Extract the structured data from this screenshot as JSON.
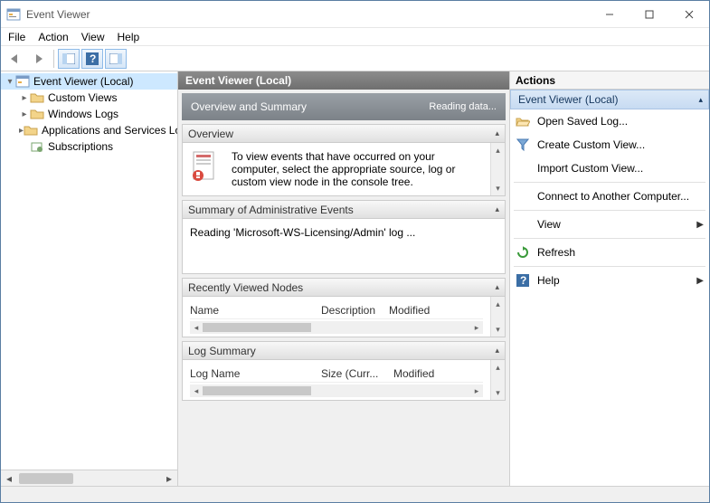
{
  "window": {
    "title": "Event Viewer"
  },
  "menu": {
    "file": "File",
    "action": "Action",
    "view": "View",
    "help": "Help"
  },
  "tree": {
    "root": "Event Viewer (Local)",
    "items": [
      {
        "label": "Custom Views"
      },
      {
        "label": "Windows Logs"
      },
      {
        "label": "Applications and Services Lo"
      },
      {
        "label": "Subscriptions"
      }
    ]
  },
  "center": {
    "header": "Event Viewer (Local)",
    "title": "Overview and Summary",
    "reading": "Reading data...",
    "overview": {
      "head": "Overview",
      "text": "To view events that have occurred on your computer, select the appropriate source, log or custom view node in the console tree."
    },
    "summary": {
      "head": "Summary of Administrative Events",
      "text": "Reading 'Microsoft-WS-Licensing/Admin' log ..."
    },
    "recent": {
      "head": "Recently Viewed Nodes",
      "cols": {
        "c1": "Name",
        "c2": "Description",
        "c3": "Modified"
      }
    },
    "logsum": {
      "head": "Log Summary",
      "cols": {
        "c1": "Log Name",
        "c2": "Size (Curr...",
        "c3": "Modified"
      }
    }
  },
  "actions": {
    "title": "Actions",
    "context": "Event Viewer (Local)",
    "items": [
      {
        "label": "Open Saved Log...",
        "icon": "folder-open-icon"
      },
      {
        "label": "Create Custom View...",
        "icon": "funnel-icon"
      },
      {
        "label": "Import Custom View...",
        "icon": ""
      },
      {
        "label": "Connect to Another Computer...",
        "icon": ""
      },
      {
        "label": "View",
        "icon": "",
        "sub": true
      },
      {
        "label": "Refresh",
        "icon": "refresh-icon"
      },
      {
        "label": "Help",
        "icon": "help-icon",
        "sub": true
      }
    ]
  }
}
